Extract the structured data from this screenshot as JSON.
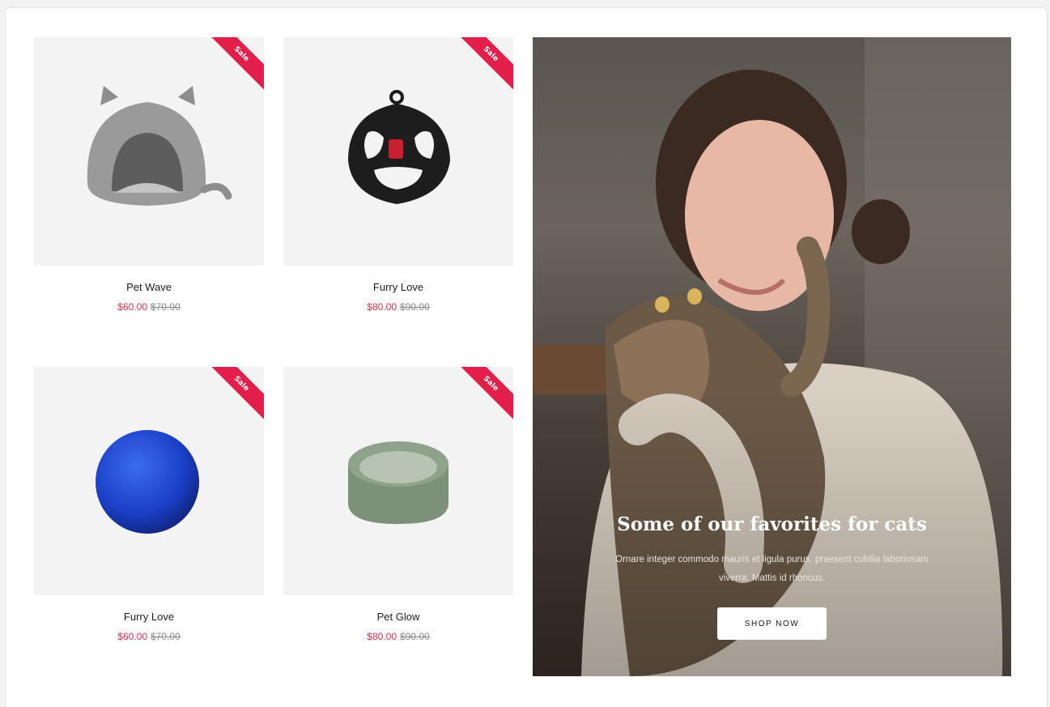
{
  "products": [
    {
      "name": "Pet Wave",
      "price": "$60.00",
      "old_price": "$70.00",
      "badge": "Sale",
      "image_icon": "cat-bed-icon"
    },
    {
      "name": "Furry Love",
      "price": "$80.00",
      "old_price": "$90.00",
      "badge": "Sale",
      "image_icon": "harness-icon"
    },
    {
      "name": "Furry Love",
      "price": "$60.00",
      "old_price": "$70.00",
      "badge": "Sale",
      "image_icon": "ball-icon"
    },
    {
      "name": "Pet Glow",
      "price": "$80.00",
      "old_price": "$90.00",
      "badge": "Sale",
      "image_icon": "bowl-icon"
    }
  ],
  "hero": {
    "title": "Some of our favorites for cats",
    "description": "Ornare integer commodo mauris et ligula purus, praesent cubilia laboriosam viverra. Mattis id rhoncus.",
    "button_label": "SHOP NOW"
  },
  "colors": {
    "sale_badge": "#e41e4a",
    "price": "#d9344f",
    "old_price": "#8a8a8a"
  }
}
